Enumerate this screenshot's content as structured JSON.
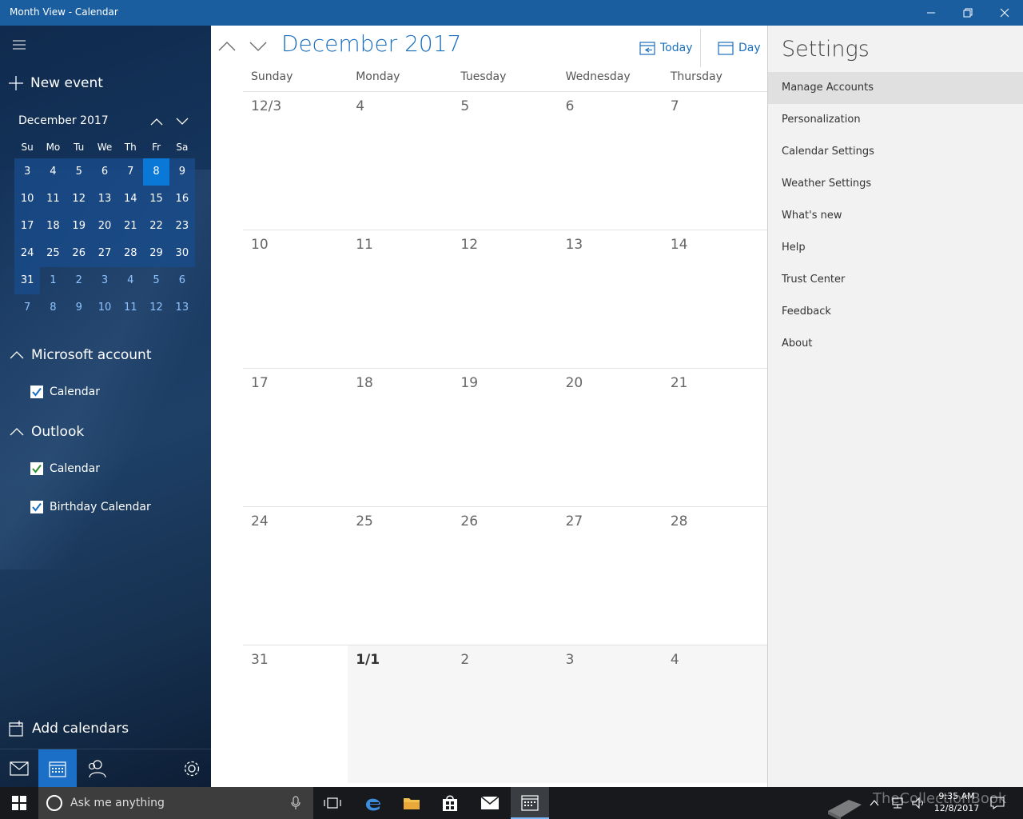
{
  "window": {
    "title": "Month View - Calendar"
  },
  "sidebar": {
    "new_event_label": "New event",
    "mini": {
      "month": "December 2017",
      "dow": [
        "Su",
        "Mo",
        "Tu",
        "We",
        "Th",
        "Fr",
        "Sa"
      ],
      "weeks": [
        [
          "3",
          "4",
          "5",
          "6",
          "7",
          "8",
          "9"
        ],
        [
          "10",
          "11",
          "12",
          "13",
          "14",
          "15",
          "16"
        ],
        [
          "17",
          "18",
          "19",
          "20",
          "21",
          "22",
          "23"
        ],
        [
          "24",
          "25",
          "26",
          "27",
          "28",
          "29",
          "30"
        ],
        [
          "31",
          "1",
          "2",
          "3",
          "4",
          "5",
          "6"
        ],
        [
          "7",
          "8",
          "9",
          "10",
          "11",
          "12",
          "13"
        ]
      ],
      "today": "8"
    },
    "groups": [
      {
        "name": "Microsoft account",
        "calendars": [
          {
            "label": "Calendar",
            "color": "#1a6fbf"
          }
        ]
      },
      {
        "name": "Outlook",
        "calendars": [
          {
            "label": "Calendar",
            "color": "#2d8c2d"
          },
          {
            "label": "Birthday Calendar",
            "color": "#1a6fbf"
          }
        ]
      }
    ],
    "add_calendars_label": "Add calendars"
  },
  "main": {
    "month_title": "December 2017",
    "today_label": "Today",
    "day_label": "Day",
    "dow": [
      "Sunday",
      "Monday",
      "Tuesday",
      "Wednesday",
      "Thursday"
    ],
    "weeks": [
      [
        "12/3",
        "4",
        "5",
        "6",
        "7"
      ],
      [
        "10",
        "11",
        "12",
        "13",
        "14"
      ],
      [
        "17",
        "18",
        "19",
        "20",
        "21"
      ],
      [
        "24",
        "25",
        "26",
        "27",
        "28"
      ],
      [
        "31",
        "1/1",
        "2",
        "3",
        "4"
      ]
    ]
  },
  "settings": {
    "title": "Settings",
    "items": [
      "Manage Accounts",
      "Personalization",
      "Calendar Settings",
      "Weather Settings",
      "What's new",
      "Help",
      "Trust Center",
      "Feedback",
      "About"
    ],
    "selected": "Manage Accounts"
  },
  "taskbar": {
    "search_placeholder": "Ask me anything",
    "time": "9:35 AM",
    "date": "12/8/2017",
    "watermark": "TheCollectionBook"
  },
  "colors": {
    "accent": "#1a6fbf",
    "titlebar": "#1a5ea0",
    "today": "#0a78d7"
  }
}
